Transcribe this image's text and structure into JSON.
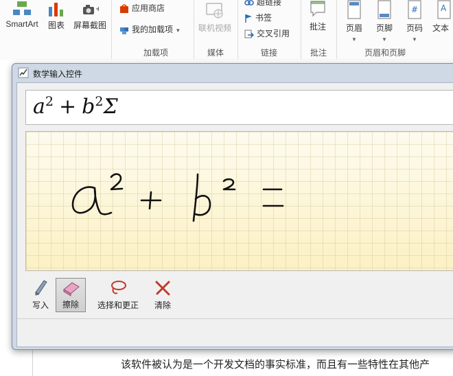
{
  "ribbon": {
    "buttons": {
      "smartart": "SmartArt",
      "chart": "图表",
      "screenshot": "屏幕截图",
      "app_store": "应用商店",
      "my_addins": "我的加载项",
      "online_video": "联机视频",
      "hyperlink": "超链接",
      "bookmark": "书签",
      "cross_reference": "交叉引用",
      "comment": "批注",
      "header": "页眉",
      "footer": "页脚",
      "page_number": "页码",
      "textbox": "文本"
    },
    "groups": {
      "addins": "加载项",
      "media": "媒体",
      "links": "链接",
      "comments": "批注",
      "header_footer": "页眉和页脚"
    },
    "page_number_glyph": "#"
  },
  "dialog": {
    "title": "数学输入控件",
    "preview": {
      "a": "a",
      "sup1": "2",
      "plus": "+",
      "b": "b",
      "sup2": "2",
      "sigma": "Σ"
    },
    "tools": {
      "write": "写入",
      "erase": "擦除",
      "select_correct": "选择和更正",
      "clear": "清除"
    }
  },
  "document": {
    "text": "该软件被认为是一个开发文档的事实标准，而且有一些特性在其他产"
  },
  "colors": {
    "pad_background": "#fdf7d8",
    "accent_red": "#c0392b",
    "office_red": "#d83b01",
    "dialog_frame": "#cfd9e5"
  }
}
